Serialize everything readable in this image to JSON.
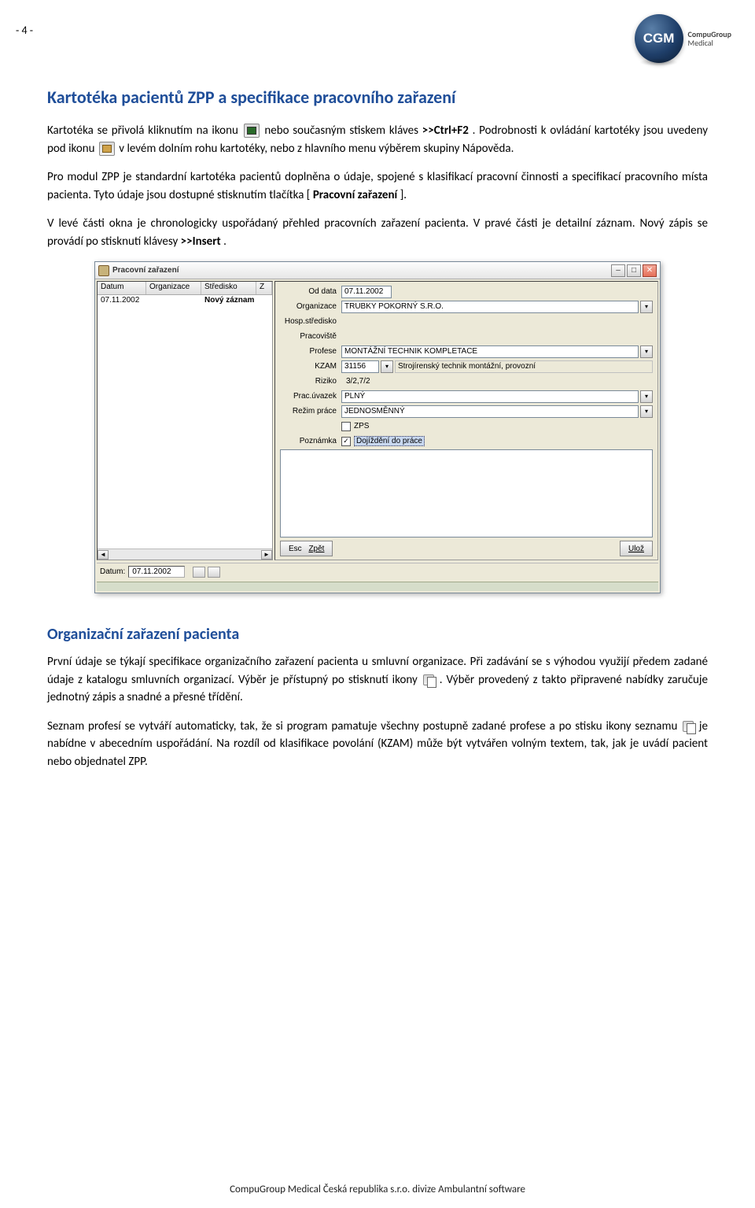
{
  "page_number": "- 4 -",
  "logo": {
    "sphere_text": "CGM",
    "line1": "CompuGroup",
    "line2": "Medical"
  },
  "heading1": "Kartotéka pacientů ZPP a specifikace pracovního zařazení",
  "para1_a": "Kartotéka se přivolá kliknutím na ikonu ",
  "para1_b": " nebo současným stiskem kláves ",
  "para1_c": ">>Ctrl+F2",
  "para1_d": ". Podrobnosti k ovládání kartotéky jsou uvedeny pod ikonu ",
  "para1_e": " v levém dolním rohu kartotéky, nebo z hlavního menu výběrem skupiny Nápověda.",
  "para2_a": "Pro modul ZPP je standardní kartotéka pacientů doplněna o údaje, spojené s klasifikací pracovní činnosti a specifikací pracovního místa pacienta. Tyto údaje jsou dostupné stisknutím tlačítka [",
  "para2_b": "Pracovní zařazení",
  "para2_c": "].",
  "para3_a": "V levé části okna je chronologicky uspořádaný přehled pracovních zařazení pacienta. V pravé části je detailní záznam. Nový zápis se provádí po stisknutí klávesy ",
  "para3_b": ">>Insert",
  "para3_c": ".",
  "app": {
    "title": "Pracovní zařazení",
    "list_headers": [
      "Datum",
      "Organizace",
      "Středisko",
      "Z"
    ],
    "list_row": {
      "date": "07.11.2002",
      "org": "",
      "stred": "Nový záznam"
    },
    "form": {
      "od_data_label": "Od data",
      "od_data_value": "07.11.2002",
      "organizace_label": "Organizace",
      "organizace_value": "TRUBKY POKORNÝ S.R.O.",
      "hosp_label": "Hosp.středisko",
      "prac_label": "Pracoviště",
      "profese_label": "Profese",
      "profese_value": "MONTÁŽNÍ TECHNIK KOMPLETACE",
      "kzam_label": "KZAM",
      "kzam_value": "31156",
      "kzam_desc": "Strojírenský technik montážní, provozní",
      "riziko_label": "Riziko",
      "riziko_value": "3/2,7/2",
      "uvazek_label": "Prac.úvazek",
      "uvazek_value": "PLNÝ",
      "rezim_label": "Režim práce",
      "rezim_value": "JEDNOSMĚNNÝ",
      "zps_label": "ZPS",
      "dojizd_label": "Dojíždění do práce",
      "pozn_label": "Poznámka"
    },
    "btn_back": "Zpět",
    "btn_back_key": "Esc",
    "btn_save": "Ulož",
    "status_label": "Datum:",
    "status_value": "07.11.2002"
  },
  "heading2": "Organizační zařazení pacienta",
  "para4": "První údaje se týkají specifikace organizačního zařazení pacienta u smluvní organizace. Při zadávání se s výhodou využijí předem zadané údaje z katalogu smluvních organizací. Výběr je přístupný po stisknutí ikony ",
  "para4_b": ". Výběr provedený z takto připravené nabídky zaručuje jednotný zápis a snadné a přesné třídění.",
  "para5_a": "Seznam profesí se vytváří automaticky, tak, že si program pamatuje všechny postupně zadané profese a po stisku ikony seznamu ",
  "para5_b": " je nabídne v abecedním uspořádání. Na rozdíl od klasifikace povolání (KZAM) může být vytvářen volným textem, tak, jak je uvádí pacient nebo objednatel ZPP.",
  "footer": "CompuGroup Medical Česká republika s.r.o. divize Ambulantní software"
}
